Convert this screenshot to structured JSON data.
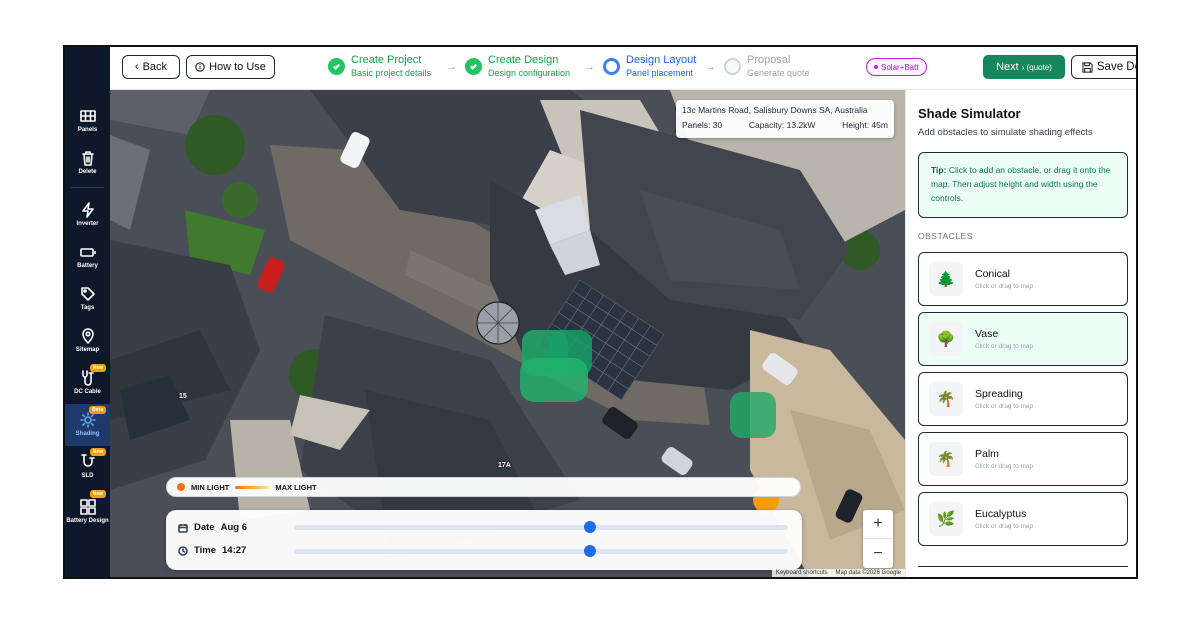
{
  "sidebar": {
    "items": [
      {
        "label": "Panels",
        "icon": "grid-icon"
      },
      {
        "label": "Delete",
        "icon": "trash-icon"
      },
      {
        "label": "Inverter",
        "icon": "bolt-icon"
      },
      {
        "label": "Battery",
        "icon": "battery-icon"
      },
      {
        "label": "Tags",
        "icon": "tag-icon"
      },
      {
        "label": "Sitemap",
        "icon": "pin-icon"
      },
      {
        "label": "DC Cable",
        "icon": "cable-icon",
        "badge": "New"
      },
      {
        "label": "Shading",
        "icon": "sun-icon",
        "badge": "Beta",
        "active": true
      },
      {
        "label": "SLD",
        "icon": "sld-icon",
        "badge": "New"
      },
      {
        "label": "Battery Design",
        "icon": "battery-design-icon",
        "badge": "New"
      }
    ]
  },
  "header": {
    "back_label": "Back",
    "how_to_label": "How to Use",
    "steps": [
      {
        "title": "Create Project",
        "subtitle": "Basic project details",
        "state": "done"
      },
      {
        "title": "Create Design",
        "subtitle": "Design configuration",
        "state": "done"
      },
      {
        "title": "Design Layout",
        "subtitle": "Panel placement",
        "state": "current"
      },
      {
        "title": "Proposal",
        "subtitle": "Generate quote",
        "state": "pending"
      }
    ],
    "badge": "Solar+Batt",
    "next_label": "Next",
    "next_sub": "› (quote)",
    "save_label": "Save Design"
  },
  "map": {
    "address": "13c Martins Road, Salisbury Downs SA, Australia",
    "panels": "Panels: 30",
    "capacity": "Capacity: 13.2kW",
    "height": "Height: 45m",
    "legend_min": "MIN LIGHT",
    "legend_max": "MAX LIGHT",
    "date_label": "Date",
    "date_value": "Aug 6",
    "time_label": "Time",
    "time_value": "14:27",
    "date_slider_fraction": 0.6,
    "time_slider_fraction": 0.6,
    "zoom_in": "+",
    "zoom_out": "−",
    "house_label_1": "15",
    "house_label_2": "17A",
    "attribution_1": "Keyboard shortcuts",
    "attribution_2": "Map data ©2026 Google"
  },
  "panel": {
    "title": "Shade Simulator",
    "subtitle": "Add obstacles to simulate shading effects",
    "tip_bold": "Tip:",
    "tip_text": "Click to add an obstacle, or drag it onto the map. Then adjust height and width using the controls.",
    "obstacles_heading": "OBSTACLES",
    "obstacles": [
      {
        "name": "Conical",
        "hint": "Click or drag to map",
        "icon": "🌲"
      },
      {
        "name": "Vase",
        "hint": "Click or drag to map",
        "icon": "🌳",
        "selected": true
      },
      {
        "name": "Spreading",
        "hint": "Click or drag to map",
        "icon": "🌴"
      },
      {
        "name": "Palm",
        "hint": "Click or drag to map",
        "icon": "🌴"
      },
      {
        "name": "Eucalyptus",
        "hint": "Click or drag to map",
        "icon": "🌿"
      }
    ]
  },
  "colors": {
    "sidebar_bg": "#0f172a",
    "accent_green": "#16875a",
    "step_done": "#22c55e",
    "step_current": "#3b82f6",
    "badge_purple": "#a21caf"
  }
}
